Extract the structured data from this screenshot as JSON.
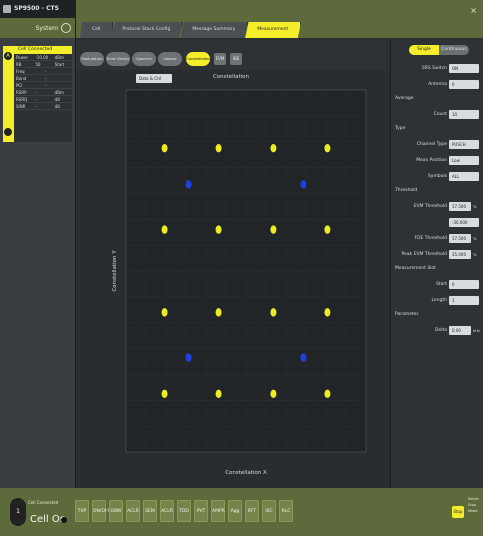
{
  "app": {
    "title": "SP9500 - CTS",
    "system_label": "System"
  },
  "cell_panel": {
    "badge": "A",
    "header": "Cell Connected",
    "rows": [
      [
        "Power",
        "-10.00",
        "dBm"
      ],
      [
        "RB",
        "50",
        "Start"
      ],
      [
        "Freq",
        "-"
      ],
      [
        "Band",
        "-"
      ],
      [
        "PCI",
        "-"
      ],
      [
        "RSRP",
        "-",
        "dBm"
      ],
      [
        "RSRQ",
        "-",
        "dB"
      ],
      [
        "SINR",
        "-",
        "dB"
      ]
    ]
  },
  "tabs": [
    {
      "label": "Cell"
    },
    {
      "label": "Protocol Stack Config"
    },
    {
      "label": "Message Summary"
    },
    {
      "label": "Measurement",
      "active": true
    }
  ],
  "toolbar": {
    "pills": [
      "Modulation",
      "Error Vector",
      "Spectral Flatness",
      "Inband Emission",
      "Constellation"
    ],
    "active": "Constellation",
    "small_buttons": [
      "EVM",
      "IBE"
    ]
  },
  "chart": {
    "dropdown": "Data & Ctrl",
    "title": "Constellation",
    "xlabel": "Constellation X",
    "ylabel": "Constellation Y"
  },
  "chart_data": {
    "type": "scatter",
    "title": "Constellation",
    "xlabel": "Constellation X",
    "ylabel": "Constellation Y",
    "xlim": [
      -1.4,
      1.4
    ],
    "ylim": [
      -1.4,
      1.4
    ],
    "grid": true,
    "series": [
      {
        "color": "#ecec21",
        "points": [
          [
            -0.95,
            0.95
          ],
          [
            -0.32,
            0.95
          ],
          [
            0.32,
            0.95
          ],
          [
            0.95,
            0.95
          ],
          [
            -0.95,
            0.32
          ],
          [
            -0.32,
            0.32
          ],
          [
            0.32,
            0.32
          ],
          [
            0.95,
            0.32
          ],
          [
            -0.95,
            -0.32
          ],
          [
            -0.32,
            -0.32
          ],
          [
            0.32,
            -0.32
          ],
          [
            0.95,
            -0.32
          ],
          [
            -0.95,
            -0.95
          ],
          [
            -0.32,
            -0.95
          ],
          [
            0.32,
            -0.95
          ],
          [
            0.95,
            -0.95
          ]
        ]
      },
      {
        "color": "#1f3fe0",
        "points": [
          [
            -0.67,
            0.67
          ],
          [
            0.67,
            0.67
          ],
          [
            -0.67,
            -0.67
          ],
          [
            0.67,
            -0.67
          ]
        ]
      }
    ]
  },
  "right_panel": {
    "seg_on": "Single",
    "seg_off": "Continuous",
    "fields": [
      {
        "label": "SRS Switch",
        "value": "ON"
      },
      {
        "label": "Antenna",
        "value": "0"
      },
      {
        "section": "Average"
      },
      {
        "label": "Count",
        "value": "10"
      },
      {
        "section": "Type"
      },
      {
        "label": "Channel Type",
        "value": "PUSCH"
      },
      {
        "label": "Meas Position",
        "value": "Low"
      },
      {
        "label": "Symbols",
        "value": "ALL"
      },
      {
        "section": "Threshold"
      },
      {
        "label": "EVM Threshold",
        "value": "17.500",
        "unit": "%"
      },
      {
        "label": "",
        "value": "-30.000"
      },
      {
        "label": "FDE Threshold",
        "value": "17.500",
        "unit": "%"
      },
      {
        "label": "Peak EVM Threshold",
        "value": "35.000",
        "unit": "%"
      },
      {
        "section": "Measurement Slot"
      },
      {
        "label": "Start",
        "value": "0"
      },
      {
        "label": "Length",
        "value": "1"
      },
      {
        "section": "Parameter"
      },
      {
        "label": "Delta",
        "value": "0.00",
        "unit": "kHz"
      }
    ]
  },
  "bottom": {
    "knob": "1",
    "caption": "Cell Connected",
    "state": "Cell On",
    "buttons": [
      "TXP",
      "ON/OFF",
      "OBW",
      "ACLR",
      "SEM",
      "ACLR",
      "TDD",
      "PVT",
      "AMPR",
      "Agg",
      "RFT",
      "ISC",
      "RLC"
    ],
    "stop_label": "Stop",
    "stop_caption": "Select Stop Mode"
  }
}
